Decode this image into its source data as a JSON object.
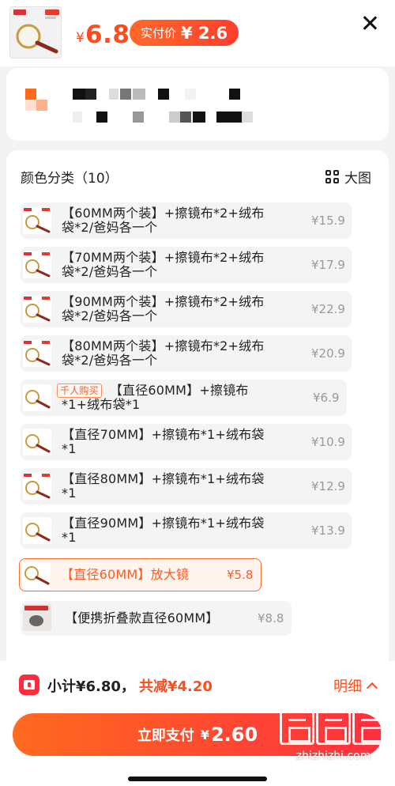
{
  "header": {
    "currency": "¥",
    "price": "6.8",
    "real_price_label": "实付价",
    "real_price_value": "¥ 2.6"
  },
  "options": {
    "title": "颜色分类（10）",
    "big_pic_label": "大图",
    "items": [
      {
        "line1": "【60MM两个装】+擦镜布*2+绒布",
        "line2": "袋*2/爸妈各一个",
        "price": "¥15.9"
      },
      {
        "line1": "【70MM两个装】+擦镜布*2+绒布",
        "line2": "袋*2/爸妈各一个",
        "price": "¥17.9"
      },
      {
        "line1": "【90MM两个装】+擦镜布*2+绒布",
        "line2": "袋*2/爸妈各一个",
        "price": "¥22.9"
      },
      {
        "line1": "【80MM两个装】+擦镜布*2+绒布",
        "line2": "袋*2/爸妈各一个",
        "price": "¥20.9"
      },
      {
        "badge": "千人购买",
        "line1": "【直径60MM】+擦镜布",
        "line2": "*1+绒布袋*1",
        "price": "¥6.9"
      },
      {
        "line1": "【直径70MM】+擦镜布*1+绒布袋",
        "line2": "*1",
        "price": "¥10.9"
      },
      {
        "line1": "【直径80MM】+擦镜布*1+绒布袋",
        "line2": "*1",
        "price": "¥12.9"
      },
      {
        "line1": "【直径90MM】+擦镜布*1+绒布袋",
        "line2": "*1",
        "price": "¥13.9"
      },
      {
        "line1": "【直径60MM】放大镜",
        "price": "¥5.8",
        "selected": true
      },
      {
        "line1": "【便携折叠款直径60MM】",
        "price": "¥8.8"
      }
    ]
  },
  "footer": {
    "subtotal": "小计¥6.80，",
    "discount": "共减¥4.20",
    "detail_label": "明细",
    "pay_label": "立即支付",
    "pay_currency": "¥",
    "pay_amount": "2.60"
  },
  "watermark_text": "zhizhizhi.com",
  "colors": {
    "accent": "#ff4c1f",
    "pay_gradient_start": "#ff6a1f",
    "pay_gradient_end": "#ff2f3e"
  }
}
